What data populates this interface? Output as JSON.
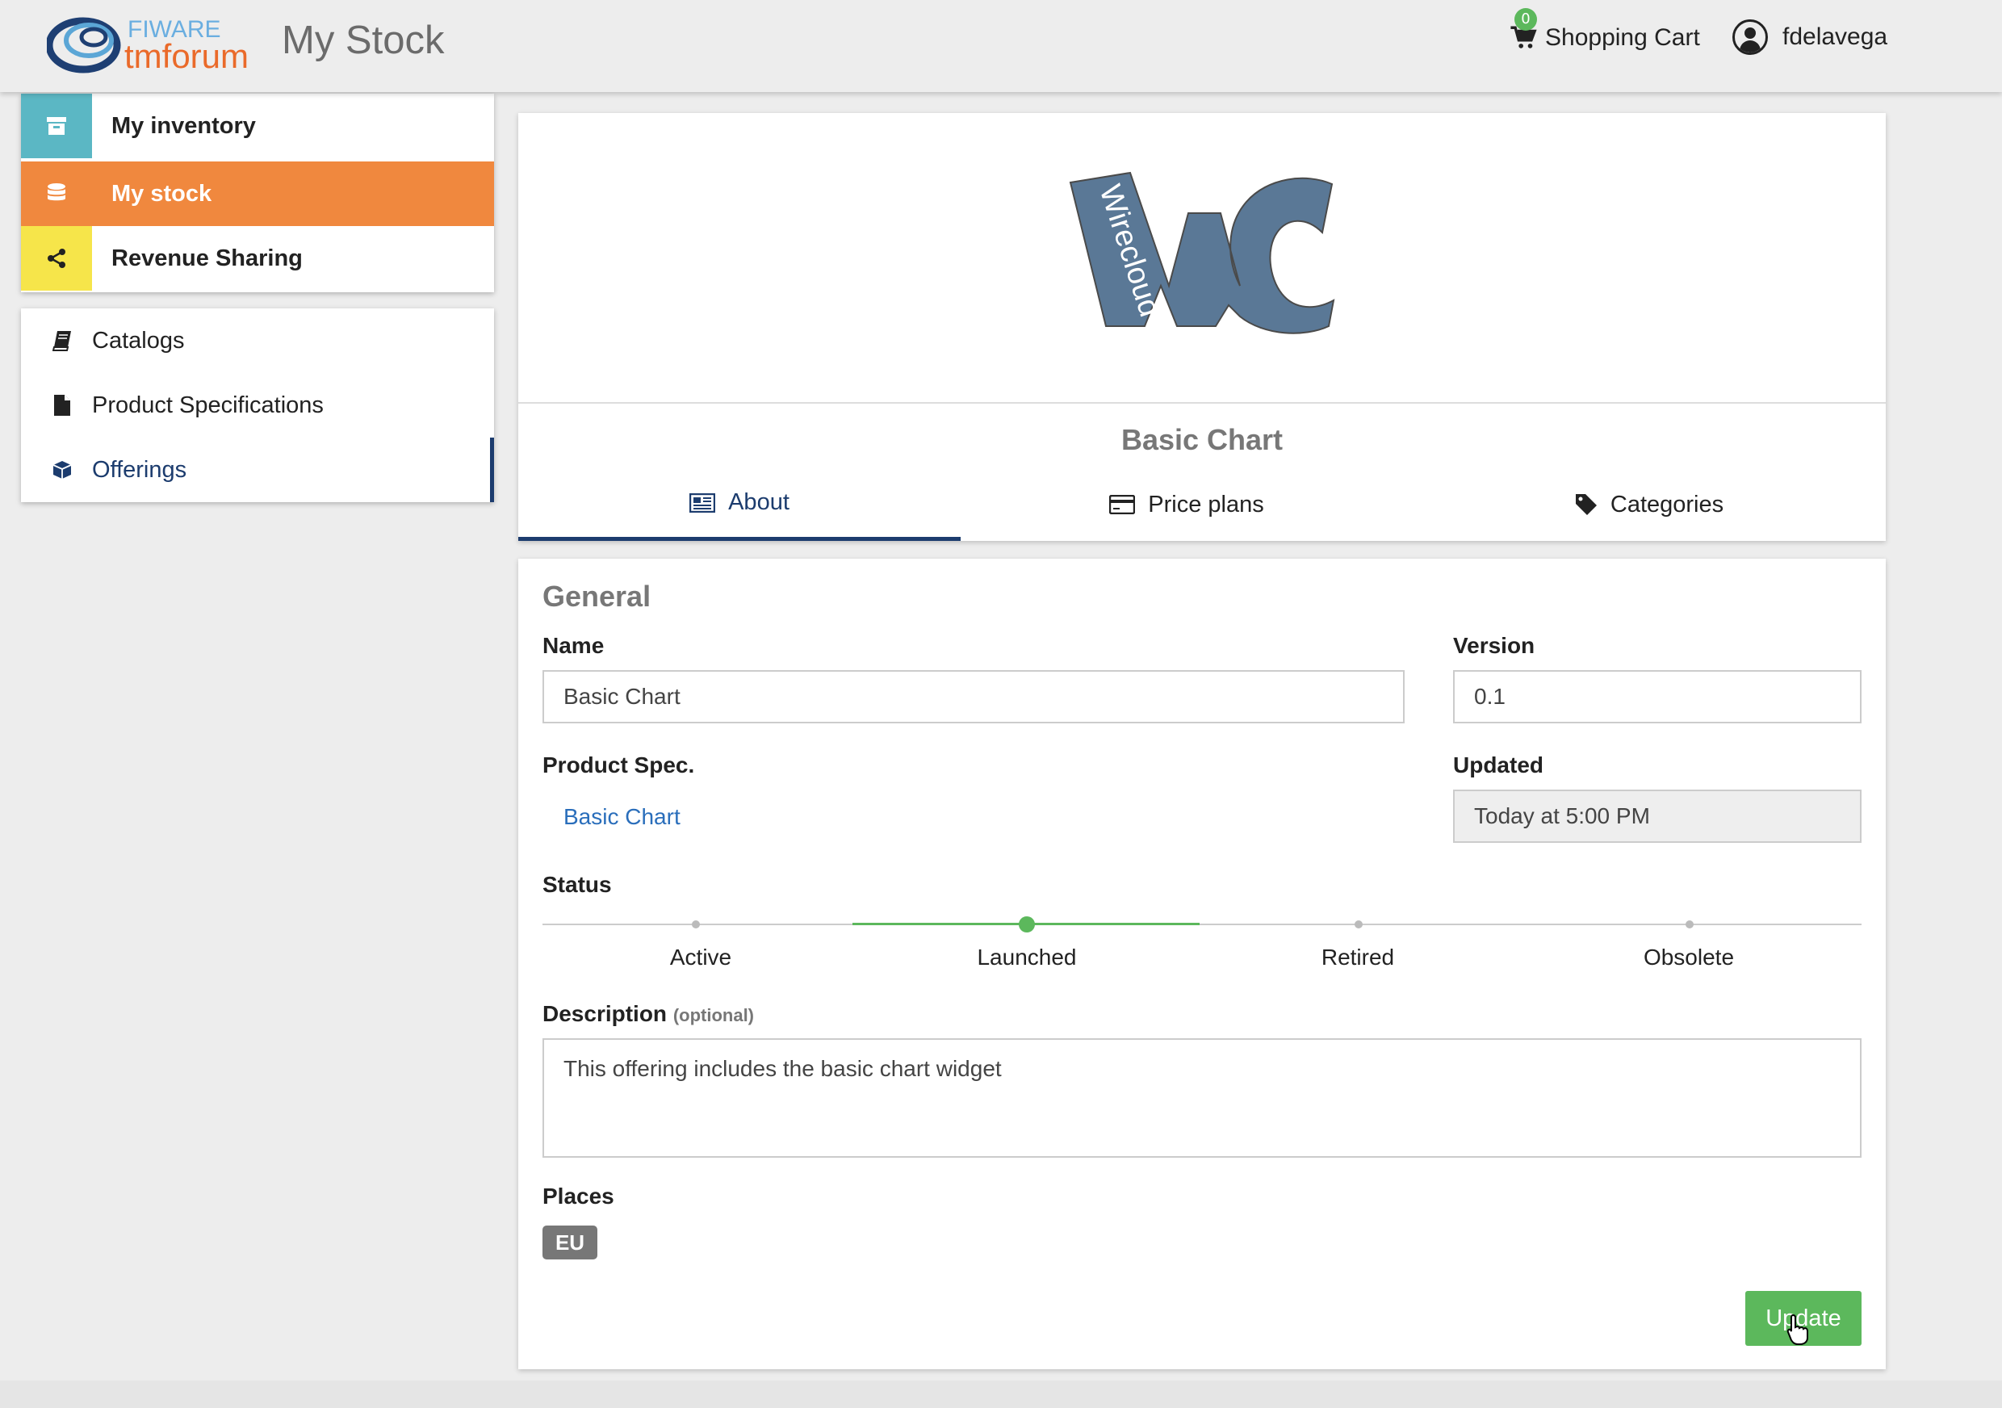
{
  "header": {
    "logo_top": "FIWARE",
    "logo_bottom": "tmforum",
    "title": "My Stock",
    "cart_label": "Shopping Cart",
    "cart_count": "0",
    "username": "fdelavega"
  },
  "sidebar": {
    "primary": [
      {
        "label": "My inventory",
        "icon": "archive-icon",
        "color": "#5bb7c4"
      },
      {
        "label": "My stock",
        "icon": "database-icon",
        "color": "#f0883e"
      },
      {
        "label": "Revenue Sharing",
        "icon": "share-icon",
        "color": "#f6e54a"
      }
    ],
    "secondary": [
      {
        "label": "Catalogs",
        "icon": "book-icon"
      },
      {
        "label": "Product Specifications",
        "icon": "file-icon"
      },
      {
        "label": "Offerings",
        "icon": "cube-icon"
      }
    ]
  },
  "product": {
    "logo_text": "Wirecloud",
    "title": "Basic Chart",
    "tabs": [
      {
        "label": "About",
        "icon": "newspaper-icon",
        "active": true
      },
      {
        "label": "Price plans",
        "icon": "credit-card-icon",
        "active": false
      },
      {
        "label": "Categories",
        "icon": "tag-icon",
        "active": false
      }
    ]
  },
  "general": {
    "section_title": "General",
    "name_label": "Name",
    "name_value": "Basic Chart",
    "version_label": "Version",
    "version_value": "0.1",
    "spec_label": "Product Spec.",
    "spec_value": "Basic Chart",
    "updated_label": "Updated",
    "updated_value": "Today at 5:00 PM",
    "status_label": "Status",
    "statuses": [
      "Active",
      "Launched",
      "Retired",
      "Obsolete"
    ],
    "status_selected": "Launched",
    "description_label": "Description",
    "description_optional": "(optional)",
    "description_value": "This offering includes the basic chart widget",
    "places_label": "Places",
    "places": [
      "EU"
    ],
    "update_button": "Update"
  },
  "colors": {
    "accent": "#1c3c6e",
    "success": "#5cb85c",
    "link": "#2a6ebb"
  }
}
